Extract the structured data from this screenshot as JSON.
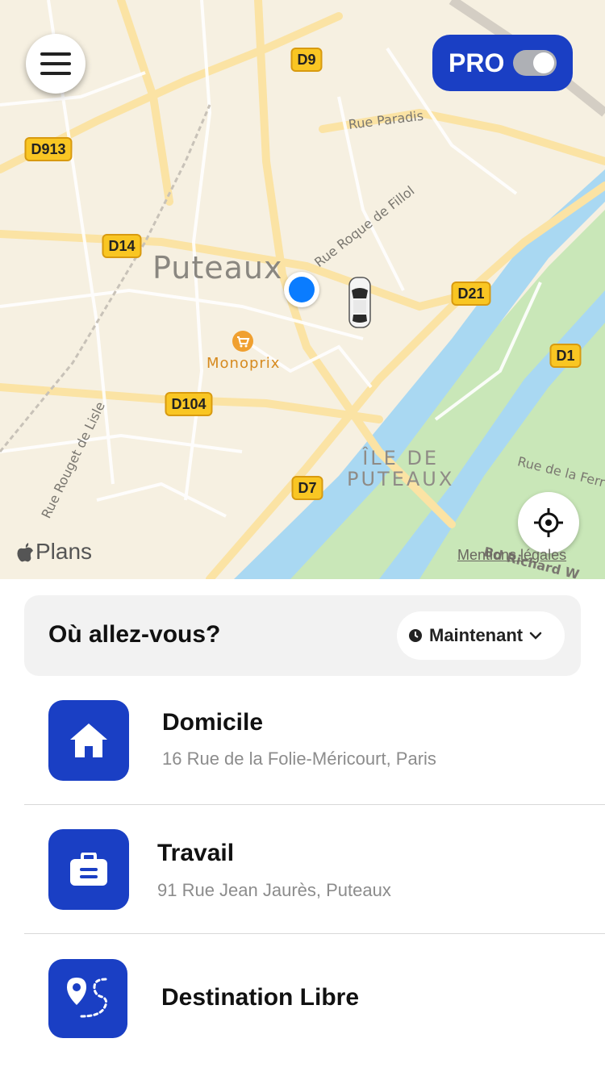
{
  "map": {
    "city_label": "Puteaux",
    "island_label_line1": "ÎLE DE",
    "island_label_line2": "PUTEAUX",
    "poi_label": "Monoprix",
    "streets": {
      "paradis": "Rue Paradis",
      "roque": "Rue Roque de Fillol",
      "rouget": "Rue Rouget de Lisle",
      "ferry": "Rue de la Ferr",
      "richard": "Bd Richard W"
    },
    "roads": [
      "D9",
      "D913",
      "D14",
      "D21",
      "D1",
      "D104",
      "D7"
    ],
    "brand": "Plans",
    "legal": "Mentions légales",
    "colors": {
      "land": "#f6f0e1",
      "water": "#a9d8f2",
      "park": "#c9e7b8",
      "road": "#fbe3a4"
    }
  },
  "header": {
    "pro_label": "PRO",
    "pro_enabled": true
  },
  "sheet": {
    "search_title": "Où allez-vous?",
    "when_label": "Maintenant",
    "places": [
      {
        "name": "Domicile",
        "address": "16 Rue de la Folie-Méricourt, Paris",
        "icon": "home-icon"
      },
      {
        "name": "Travail",
        "address": "91 Rue Jean Jaurès, Puteaux",
        "icon": "briefcase-icon"
      },
      {
        "name": "Destination Libre",
        "address": "",
        "icon": "route-pin-icon"
      }
    ]
  },
  "accent_color": "#1a3fc4"
}
